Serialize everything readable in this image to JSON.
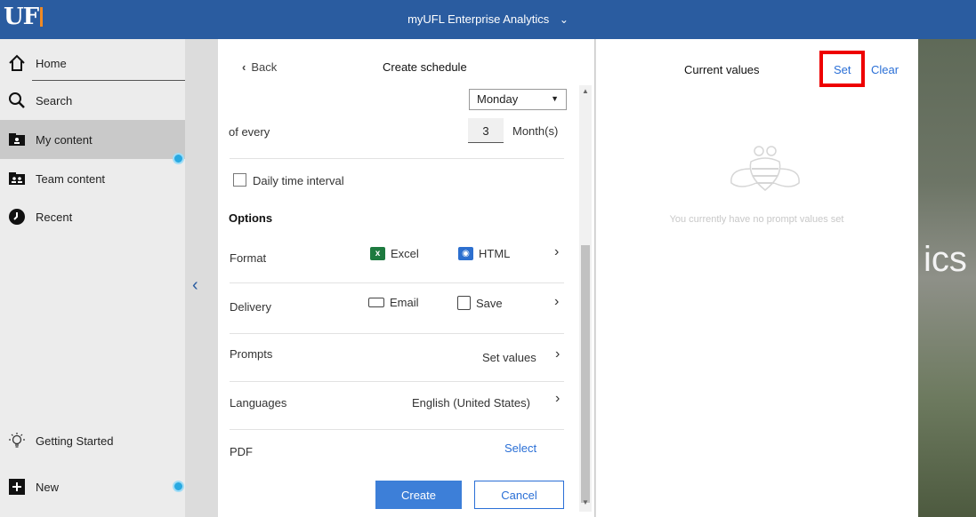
{
  "header": {
    "logo_text": "UF",
    "app_title": "myUFL Enterprise Analytics"
  },
  "background": {
    "partial_word": "ics"
  },
  "sidebar": {
    "items": [
      {
        "label": "Home",
        "icon": "home-icon"
      },
      {
        "label": "Search",
        "icon": "search-icon"
      },
      {
        "label": "My content",
        "icon": "my-content-icon"
      },
      {
        "label": "Team content",
        "icon": "team-content-icon"
      },
      {
        "label": "Recent",
        "icon": "recent-icon"
      },
      {
        "label": "Getting Started",
        "icon": "lightbulb-icon"
      },
      {
        "label": "New",
        "icon": "plus-icon"
      }
    ],
    "accent_color": "#29a9e1"
  },
  "schedule": {
    "back_label": "Back",
    "title": "Create schedule",
    "day_select": "Monday",
    "of_every_label": "of every",
    "interval_value": "3",
    "interval_unit": "Month(s)",
    "daily_interval_label": "Daily time interval",
    "options_heading": "Options",
    "format_label": "Format",
    "format_excel": "Excel",
    "format_html": "HTML",
    "delivery_label": "Delivery",
    "delivery_email": "Email",
    "delivery_save": "Save",
    "prompts_label": "Prompts",
    "prompts_value": "Set values",
    "languages_label": "Languages",
    "languages_value": "English (United States)",
    "pdf_label": "PDF",
    "pdf_value": "Select",
    "create_label": "Create",
    "cancel_label": "Cancel"
  },
  "prompt_panel": {
    "title": "Current values",
    "set_label": "Set",
    "clear_label": "Clear",
    "empty_message": "You currently have no prompt values set",
    "highlight_color": "#ee0000"
  }
}
